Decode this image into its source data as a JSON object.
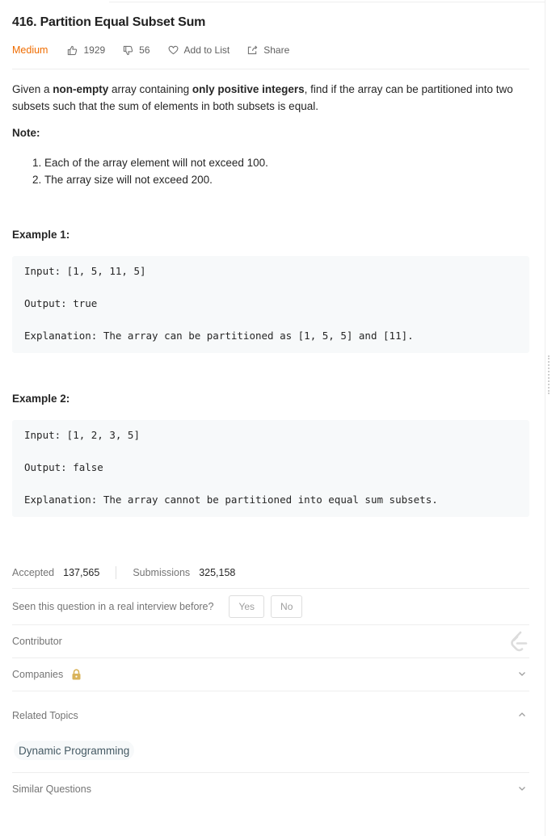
{
  "problem": {
    "title": "416. Partition Equal Subset Sum",
    "difficulty": "Medium",
    "likes": "1929",
    "dislikes": "56",
    "add_to_list": "Add to List",
    "share": "Share",
    "colors": {
      "difficulty": "#ef6c00",
      "code_bg": "#f7f9fa"
    }
  },
  "description": {
    "text_1": "Given a ",
    "bold_1": "non-empty",
    "text_2": " array containing ",
    "bold_2": "only positive integers",
    "text_3": ", find if the array can be partitioned into two subsets such that the sum of elements in both subsets is equal.",
    "note_label": "Note:",
    "notes": [
      "Each of the array element will not exceed 100.",
      "The array size will not exceed 200."
    ]
  },
  "examples": [
    {
      "label": "Example 1:",
      "input": "Input: [1, 5, 11, 5]",
      "output": "Output: true",
      "explanation": "Explanation: The array can be partitioned as [1, 5, 5] and [11]."
    },
    {
      "label": "Example 2:",
      "input": "Input: [1, 2, 3, 5]",
      "output": "Output: false",
      "explanation": "Explanation: The array cannot be partitioned into equal sum subsets."
    }
  ],
  "stats": {
    "accepted_label": "Accepted",
    "accepted_value": "137,565",
    "submissions_label": "Submissions",
    "submissions_value": "325,158"
  },
  "interview": {
    "question": "Seen this question in a real interview before?",
    "yes": "Yes",
    "no": "No"
  },
  "sections": {
    "contributor": "Contributor",
    "companies": "Companies",
    "related_topics": "Related Topics",
    "related_tags": [
      "Dynamic Programming"
    ],
    "similar_questions": "Similar Questions"
  },
  "icons": {
    "like": "thumbs-up-icon",
    "dislike": "thumbs-down-icon",
    "add_to_list": "heart-icon",
    "share": "share-icon",
    "contributor": "leetcode-logo-icon",
    "companies": "lock-icon",
    "collapse": "chevron-up-icon",
    "expand": "chevron-down-icon"
  }
}
